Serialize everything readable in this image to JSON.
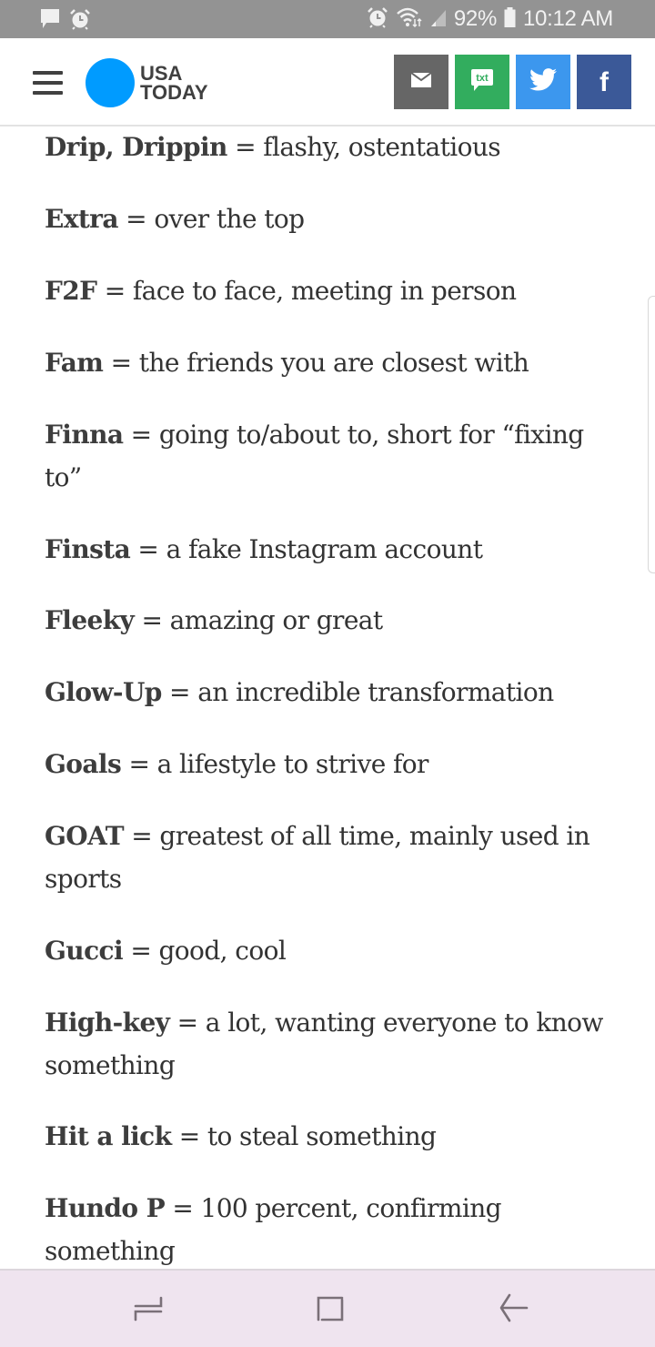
{
  "status_bar": {
    "notification_icons": [
      "message-icon",
      "alarm-icon"
    ],
    "system_icons": [
      "alarm-icon",
      "wifi-icon",
      "signal-icon"
    ],
    "battery_percent": "92%",
    "time": "10:12 AM"
  },
  "header": {
    "menu_icon": "hamburger-menu-icon",
    "logo": {
      "line1": "USA",
      "line2": "TODAY",
      "brand_color": "#009bff"
    },
    "share_buttons": [
      {
        "name": "email",
        "icon": "envelope-icon",
        "color": "#666666"
      },
      {
        "name": "text",
        "icon": "txt-bubble-icon",
        "label": "txt",
        "color": "#32ad5e"
      },
      {
        "name": "twitter",
        "icon": "twitter-bird-icon",
        "color": "#3c97ee"
      },
      {
        "name": "facebook",
        "icon": "facebook-icon",
        "label": "f",
        "color": "#3b5998"
      }
    ]
  },
  "article": {
    "entries": [
      {
        "term": "Drip, Drippin",
        "definition": " = flashy, ostentatious"
      },
      {
        "term": "Extra",
        "definition": " = over the top"
      },
      {
        "term": "F2F",
        "definition": " = face to face, meeting in person"
      },
      {
        "term": "Fam",
        "definition": " = the friends you are closest with"
      },
      {
        "term": "Finna",
        "definition": " = going to/about to, short for “fixing to”"
      },
      {
        "term": "Finsta",
        "definition": " = a fake Instagram account"
      },
      {
        "term": "Fleeky",
        "definition": " = amazing or great"
      },
      {
        "term": "Glow-Up",
        "definition": " = an incredible transformation"
      },
      {
        "term": "Goals",
        "definition": " = a lifestyle to strive for"
      },
      {
        "term": "GOAT",
        "definition": " = greatest of all time, mainly used in sports"
      },
      {
        "term": "Gucci",
        "definition": " = good, cool"
      },
      {
        "term": "High-key",
        "definition": " = a lot, wanting everyone to know something"
      },
      {
        "term": "Hit a lick",
        "definition": " = to steal something"
      },
      {
        "term": "Hundo P",
        "definition": " = 100 percent, confirming something"
      }
    ]
  },
  "nav_bar": {
    "buttons": [
      {
        "name": "recent-apps",
        "icon": "recent-apps-icon"
      },
      {
        "name": "home",
        "icon": "home-icon"
      },
      {
        "name": "back",
        "icon": "back-arrow-icon"
      }
    ]
  }
}
